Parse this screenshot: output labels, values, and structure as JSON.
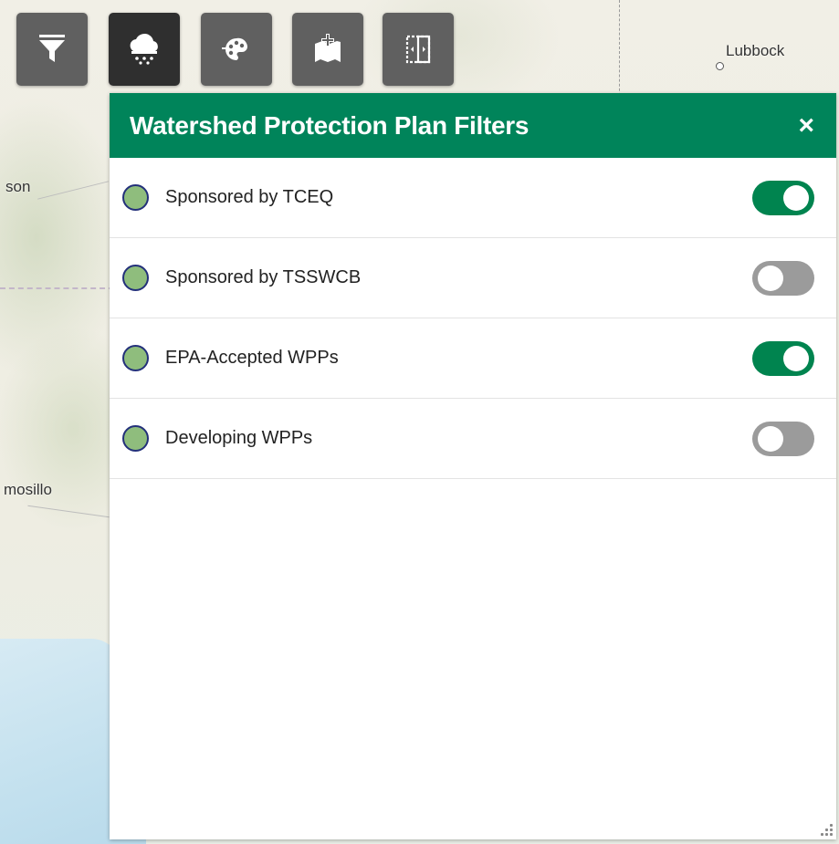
{
  "map": {
    "labels": {
      "lubbock": "Lubbock",
      "son": "son",
      "hermosillo": "mosillo"
    }
  },
  "toolbar": {
    "buttons": [
      {
        "icon": "filter-icon",
        "active": false
      },
      {
        "icon": "rain-cloud-icon",
        "active": true
      },
      {
        "icon": "palette-icon",
        "active": false
      },
      {
        "icon": "add-map-icon",
        "active": false
      },
      {
        "icon": "swipe-compare-icon",
        "active": false
      }
    ]
  },
  "panel": {
    "title": "Watershed Protection Plan Filters",
    "close_label": "×",
    "filters": [
      {
        "label": "Sponsored by TCEQ",
        "on": true
      },
      {
        "label": "Sponsored by TSSWCB",
        "on": false
      },
      {
        "label": "EPA-Accepted WPPs",
        "on": true
      },
      {
        "label": "Developing WPPs",
        "on": false
      }
    ]
  },
  "colors": {
    "header_green": "#00845a",
    "toggle_on": "#00844f",
    "toggle_off": "#9b9b9b",
    "swatch_fill": "#8fbd7d",
    "swatch_border": "#23307a",
    "button_bg": "#606060",
    "button_active_bg": "#2f2f2f"
  }
}
